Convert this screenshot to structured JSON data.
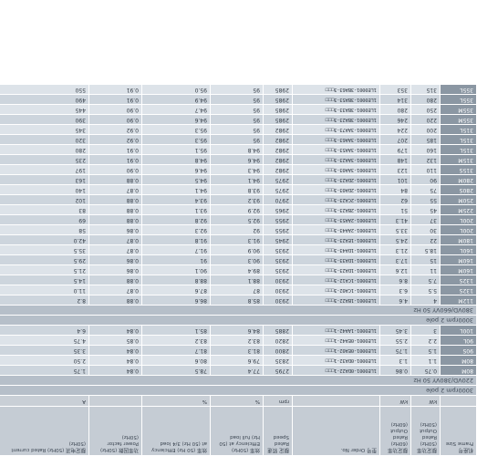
{
  "header": {
    "frame": "机座号 Frame Size",
    "kw": "额定功率 (50Hz) Rated Output (50Hz)",
    "kw2": "额定功率 (60Hz) Rated Output (60Hz)",
    "order": "型号 Order No.",
    "rpm": "额定 转速 Rated Speed",
    "eff_full": "效率 (50Hz) Efficiency at (50 Hz) full load",
    "eff_34": "效率 (50 Hz) Efficiency at (50 Hz) 3/4 load",
    "pf": "功率因数 (50Hz) Power factor (50Hz)",
    "cur": "额定电流 (50Hz) Rated current (50Hz)"
  },
  "units": {
    "kw": "kW",
    "kw2": "kW",
    "rpm": "rpm",
    "eff_full": "%",
    "eff_34": "%",
    "pf": "",
    "cur": "A"
  },
  "sections": [
    {
      "title": "3000rpm 2 pole",
      "voltage": "220VD/380VY 50 Hz",
      "rows": [
        {
          "frame": "80M",
          "kw": "0.75",
          "kw2": "0.86",
          "order": "1LE0001-0DA22-1□□□",
          "rpm": "2795",
          "eff_full": "77.4",
          "eff_34": "78.5",
          "pf": "0.84",
          "cur": "1.75"
        },
        {
          "frame": "80M",
          "kw": "1.1",
          "kw2": "1.3",
          "order": "1LE0001-0DA32-1□□□",
          "rpm": "2835",
          "eff_full": "79.6",
          "eff_34": "80.6",
          "pf": "0.84",
          "cur": "2.50"
        },
        {
          "frame": "90S",
          "kw": "1.5",
          "kw2": "1.75",
          "order": "1LE0001-0EA02-1□□□",
          "rpm": "2800",
          "eff_full": "81.3",
          "eff_34": "81.7",
          "pf": "0.84",
          "cur": "3.35"
        },
        {
          "frame": "90L",
          "kw": "2.2",
          "kw2": "2.55",
          "order": "1LE0001-0EA42-1□□□",
          "rpm": "2820",
          "eff_full": "83.2",
          "eff_34": "83.2",
          "pf": "0.85",
          "cur": "4.75"
        },
        {
          "frame": "100L",
          "kw": "3",
          "kw2": "3.45",
          "order": "1LE0001-1AA42-1□□□",
          "rpm": "2885",
          "eff_full": "84.6",
          "eff_34": "85.1",
          "pf": "0.84",
          "cur": "6.4"
        }
      ]
    },
    {
      "title": "3000rpm 2 pole",
      "voltage": "380VD/660VY 50 Hz",
      "rows": [
        {
          "frame": "112M",
          "kw": "4",
          "kw2": "4.6",
          "order": "1LE0001-1BA22-3□□□",
          "rpm": "2930",
          "eff_full": "85.8",
          "eff_34": "86.6",
          "pf": "0.88",
          "cur": "8.2"
        },
        {
          "frame": "132S",
          "kw": "5.5",
          "kw2": "6.3",
          "order": "1LE0001-1CA02-3□□□",
          "rpm": "2930",
          "eff_full": "87",
          "eff_34": "87.6",
          "pf": "0.87",
          "cur": "11.0"
        },
        {
          "frame": "132S",
          "kw": "7.5",
          "kw2": "8.6",
          "order": "1LE0001-1CA12-3□□□",
          "rpm": "2930",
          "eff_full": "88.1",
          "eff_34": "88.8",
          "pf": "0.88",
          "cur": "14.5"
        },
        {
          "frame": "160M",
          "kw": "11",
          "kw2": "12.6",
          "order": "1LE0001-1DA23-3□□□",
          "rpm": "2935",
          "eff_full": "89.4",
          "eff_34": "90.1",
          "pf": "0.86",
          "cur": "21.5"
        },
        {
          "frame": "160M",
          "kw": "15",
          "kw2": "17.3",
          "order": "1LE0001-1DA33-3□□□",
          "rpm": "2935",
          "eff_full": "90.3",
          "eff_34": "91",
          "pf": "0.86",
          "cur": "29.5"
        },
        {
          "frame": "160L",
          "kw": "18.5",
          "kw2": "21.3",
          "order": "1LE0001-1DA43-3□□□",
          "rpm": "2935",
          "eff_full": "90.9",
          "eff_34": "91.7",
          "pf": "0.87",
          "cur": "35.5"
        },
        {
          "frame": "180M",
          "kw": "22",
          "kw2": "24.5",
          "order": "1LE0001-1EA23-3□□□",
          "rpm": "2945",
          "eff_full": "91.3",
          "eff_34": "91.8",
          "pf": "0.87",
          "cur": "42.0"
        },
        {
          "frame": "200L",
          "kw": "30",
          "kw2": "33.5",
          "order": "1LE0001-2AA43-3□□□",
          "rpm": "2955",
          "eff_full": "92",
          "eff_34": "92.3",
          "pf": "0.86",
          "cur": "58"
        },
        {
          "frame": "200L",
          "kw": "37",
          "kw2": "41.3",
          "order": "1LE0001-2AA53-3□□□",
          "rpm": "2955",
          "eff_full": "92.5",
          "eff_34": "92.8",
          "pf": "0.88",
          "cur": "69"
        },
        {
          "frame": "225M",
          "kw": "45",
          "kw2": "51",
          "order": "1LE0001-2BA23-3□□□",
          "rpm": "2965",
          "eff_full": "92.9",
          "eff_34": "93.1",
          "pf": "0.88",
          "cur": "83"
        },
        {
          "frame": "250M",
          "kw": "55",
          "kw2": "62",
          "order": "1LE0001-2CA23-3□□□",
          "rpm": "2970",
          "eff_full": "93.2",
          "eff_34": "93.4",
          "pf": "0.88",
          "cur": "102"
        },
        {
          "frame": "280S",
          "kw": "75",
          "kw2": "84",
          "order": "1LE0001-2DA03-3□□□",
          "rpm": "2975",
          "eff_full": "93.8",
          "eff_34": "94.1",
          "pf": "0.87",
          "cur": "140"
        },
        {
          "frame": "280M",
          "kw": "90",
          "kw2": "101",
          "order": "1LE0001-2DA23-3□□□",
          "rpm": "2975",
          "eff_full": "94.1",
          "eff_34": "94.5",
          "pf": "0.88",
          "cur": "163"
        },
        {
          "frame": "315S",
          "kw": "110",
          "kw2": "123",
          "order": "1LE0001-3AA03-3□□□",
          "rpm": "2982",
          "eff_full": "94.3",
          "eff_34": "94.6",
          "pf": "0.90",
          "cur": "197"
        },
        {
          "frame": "315M",
          "kw": "132",
          "kw2": "148",
          "order": "1LE0001-3AA23-3□□□",
          "rpm": "2982",
          "eff_full": "94.6",
          "eff_34": "94.8",
          "pf": "0.91",
          "cur": "235"
        },
        {
          "frame": "315L",
          "kw": "160",
          "kw2": "179",
          "order": "1LE0001-3AA53-3□□□",
          "rpm": "2982",
          "eff_full": "94.8",
          "eff_34": "95.1",
          "pf": "0.91",
          "cur": "280"
        },
        {
          "frame": "315L",
          "kw": "185",
          "kw2": "207",
          "order": "1LE0001-3AA63-3□□□",
          "rpm": "2982",
          "eff_full": "95",
          "eff_34": "95.3",
          "pf": "0.92",
          "cur": "320"
        },
        {
          "frame": "315L",
          "kw": "200",
          "kw2": "224",
          "order": "1LE0001-3AA73-3□□□",
          "rpm": "2982",
          "eff_full": "95",
          "eff_34": "95.3",
          "pf": "0.92",
          "cur": "345"
        },
        {
          "frame": "355M",
          "kw": "220",
          "kw2": "246",
          "order": "1LE0001-3BA23-3□□□",
          "rpm": "2985",
          "eff_full": "95",
          "eff_34": "94.6",
          "pf": "0.90",
          "cur": "390"
        },
        {
          "frame": "355M",
          "kw": "250",
          "kw2": "280",
          "order": "1LE0001-3BA33-3□□□",
          "rpm": "2985",
          "eff_full": "95",
          "eff_34": "94.7",
          "pf": "0.90",
          "cur": "445"
        },
        {
          "frame": "355L",
          "kw": "280",
          "kw2": "314",
          "order": "1LE0001-3BA53-3□□□",
          "rpm": "2985",
          "eff_full": "95",
          "eff_34": "94.9",
          "pf": "0.91",
          "cur": "490"
        },
        {
          "frame": "355L",
          "kw": "315",
          "kw2": "353",
          "order": "1LE0001-3BA63-3□□□",
          "rpm": "2985",
          "eff_full": "95",
          "eff_34": "95.0",
          "pf": "0.91",
          "cur": "550"
        }
      ]
    }
  ]
}
